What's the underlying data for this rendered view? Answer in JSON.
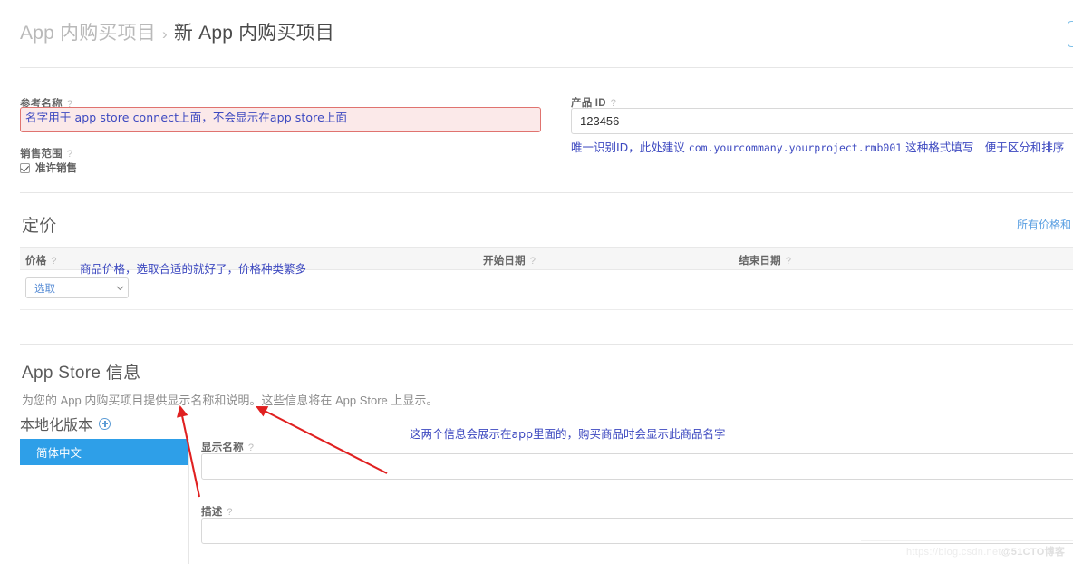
{
  "breadcrumb": {
    "parent": "App 内购买项目",
    "separator": "›",
    "current": "新 App 内购买项目"
  },
  "reference_name": {
    "label": "参考名称",
    "help": "?",
    "value": "",
    "annotation": "名字用于 app store connect上面，不会显示在app store上面",
    "state": "error"
  },
  "sales_scope": {
    "label": "销售范围",
    "help": "?",
    "checkbox_label": "准许销售",
    "checked": true
  },
  "product_id": {
    "label": "产品 ID",
    "help": "?",
    "value": "123456",
    "annotation_prefix": "唯一识别ID，此处建议",
    "annotation_mono": "com.yourcommany.yourproject.rmb001",
    "annotation_suffix": "这种格式填写　便于区分和排序"
  },
  "pricing": {
    "section_title": "定价",
    "all_prices_link": "所有价格和",
    "columns": {
      "price": "价格",
      "start_date": "开始日期",
      "end_date": "结束日期"
    },
    "help": "?",
    "price_select_value": "选取",
    "chevron": "⌄",
    "annotation": "商品价格，选取合适的就好了，价格种类繁多"
  },
  "app_store_info": {
    "section_title": "App Store 信息",
    "description": "为您的 App 内购买项目提供显示名称和说明。这些信息将在 App Store 上显示。",
    "localization_title": "本地化版本",
    "add_icon": "plus-circle-icon",
    "locales": [
      {
        "label": "简体中文",
        "active": true
      }
    ],
    "annotation": "这两个信息会展示在app里面的，购买商品时会显示此商品名字",
    "display_name": {
      "label": "显示名称",
      "help": "?",
      "value": ""
    },
    "description_field": {
      "label": "描述",
      "help": "?",
      "value": ""
    }
  },
  "save_button": {
    "label": ""
  },
  "watermark": {
    "site": "https://blog.csdn.net",
    "brand": "@51CTO博客"
  },
  "colors": {
    "annotation_blue": "#3d49c0",
    "arrow_red": "#e02020",
    "accent_blue": "#2e9fe8",
    "link_blue": "#5a9fe2",
    "error_border": "#e0736f",
    "error_bg": "#fbe9e9"
  }
}
